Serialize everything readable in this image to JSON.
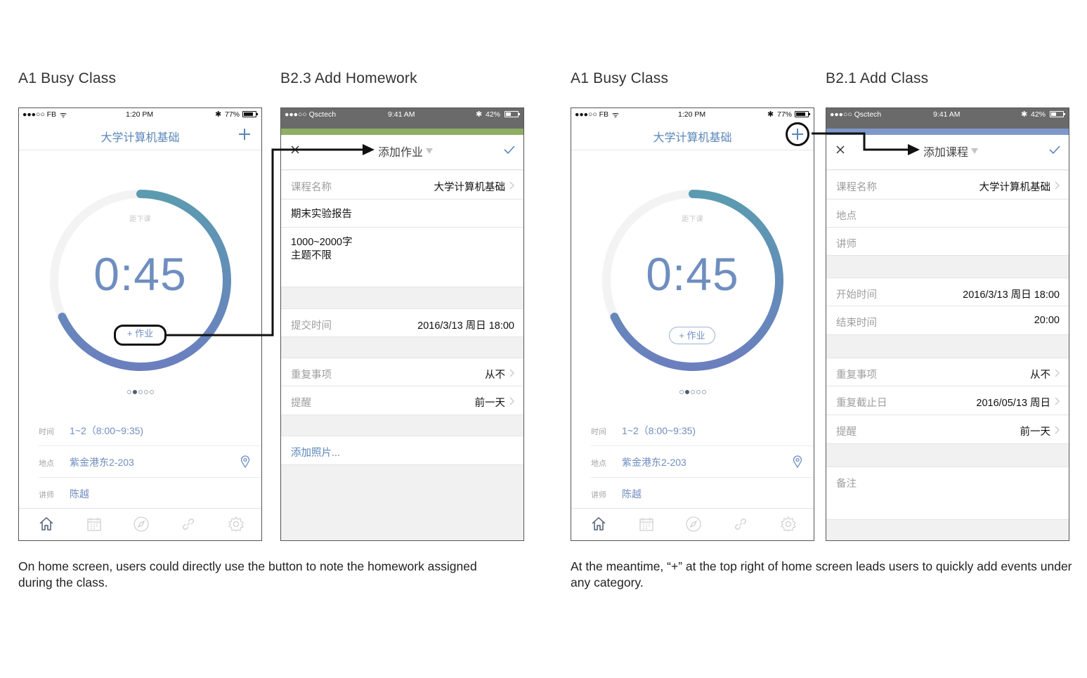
{
  "panels": {
    "p1_title": "A1 Busy Class",
    "p2_title": "B2.3 Add Homework",
    "p3_title": "A1 Busy Class",
    "p4_title": "B2.1 Add Class"
  },
  "captions": {
    "left": "On home screen, users could directly use the button to note the homework assigned during the class.",
    "right": "At the meantime, “+” at the top right of home screen leads users to quickly add events under any category."
  },
  "home": {
    "status": {
      "carrier": "●●●○○ FB",
      "time": "1:20 PM",
      "battery": "77%",
      "battery_level": 0.77
    },
    "course_title": "大学计算机基础",
    "countdown_label": "距下课",
    "countdown": "0:45",
    "progress_fraction": 0.62,
    "homework_button": "+ 作业",
    "page_dots": {
      "count": 5,
      "active": 1
    },
    "info": [
      {
        "key": "时间",
        "value": "1~2（8:00~9:35)"
      },
      {
        "key": "地点",
        "value": "紫金港东2-203"
      },
      {
        "key": "讲师",
        "value": "陈越"
      }
    ],
    "tabs": [
      "home-icon",
      "calendar-icon",
      "compass-icon",
      "link-icon",
      "settings-icon"
    ],
    "colors": {
      "accent": "#5b86b8",
      "ring_start": "#5b9bb0",
      "ring_end": "#6b7fbf"
    }
  },
  "add_homework": {
    "status": {
      "carrier": "●●●○○ Qsctech",
      "time": "9:41 AM",
      "battery": "42%",
      "battery_level": 0.42
    },
    "band_color": "#8fae64",
    "title": "添加作业",
    "course_key": "课程名称",
    "course_value": "大学计算机基础",
    "homework_title": "期末实验报告",
    "note_line1": "1000~2000字",
    "note_line2": "主题不限",
    "due_key": "提交时间",
    "due_value": "2016/3/13 周日 18:00",
    "repeat_key": "重复事项",
    "repeat_value": "从不",
    "remind_key": "提醒",
    "remind_value": "前一天",
    "add_photo": "添加照片..."
  },
  "add_class": {
    "status": {
      "carrier": "●●●○○ Qsctech",
      "time": "9:41 AM",
      "battery": "42%",
      "battery_level": 0.42
    },
    "band_color": "#7f98cc",
    "title": "添加课程",
    "course_key": "课程名称",
    "course_value": "大学计算机基础",
    "location_key": "地点",
    "lecturer_key": "讲师",
    "start_key": "开始时间",
    "start_value": "2016/3/13 周日 18:00",
    "end_key": "结束时间",
    "end_value": "20:00",
    "repeat_key": "重复事项",
    "repeat_value": "从不",
    "repeat_end_key": "重复截止日",
    "repeat_end_value": "2016/05/13 周日",
    "remind_key": "提醒",
    "remind_value": "前一天",
    "notes_key": "备注"
  }
}
